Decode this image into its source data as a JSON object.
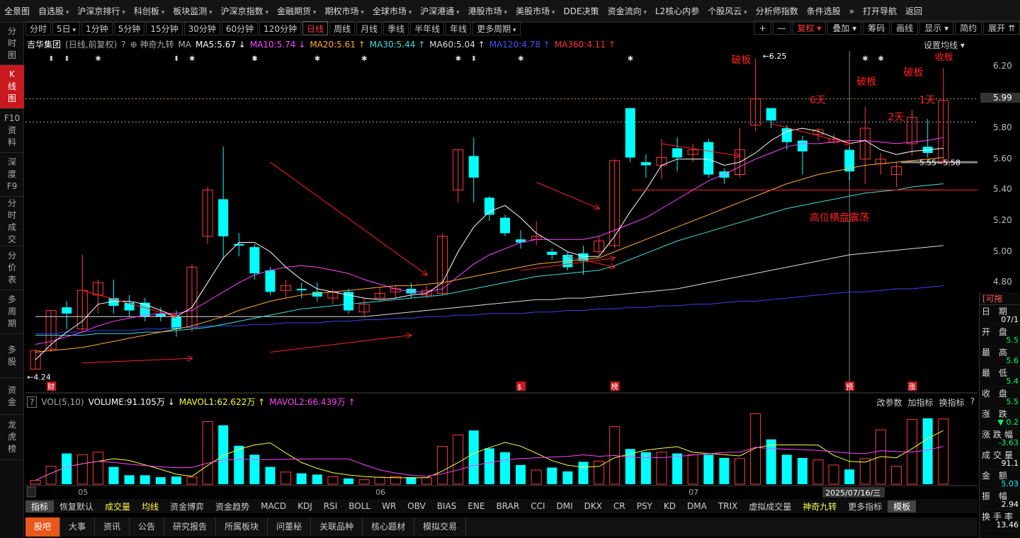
{
  "top_menu": [
    {
      "label": "全景图",
      "dd": false
    },
    {
      "label": "自选股",
      "dd": true
    },
    {
      "label": "沪深京排行",
      "dd": true
    },
    {
      "label": "科创板",
      "dd": true
    },
    {
      "label": "板块监测",
      "dd": true
    },
    {
      "label": "沪深京指数",
      "dd": true
    },
    {
      "label": "金融期货",
      "dd": true
    },
    {
      "label": "期权市场",
      "dd": true
    },
    {
      "label": "全球市场",
      "dd": true
    },
    {
      "label": "沪深港通",
      "dd": true
    },
    {
      "label": "港股市场",
      "dd": true
    },
    {
      "label": "美股市场",
      "dd": true
    },
    {
      "label": "DDE决策",
      "dd": false
    },
    {
      "label": "资金流向",
      "dd": true
    },
    {
      "label": "L2核心内参",
      "dd": false
    },
    {
      "label": "个股风云",
      "dd": true
    },
    {
      "label": "分析师指数",
      "dd": false
    },
    {
      "label": "条件选股",
      "dd": false
    },
    {
      "label": "»",
      "dd": false
    },
    {
      "label": "打开导航",
      "dd": false
    },
    {
      "label": "返回",
      "dd": false
    }
  ],
  "sidebar": [
    {
      "label": "分\n时\n图",
      "h": 60,
      "active": false
    },
    {
      "label": "K\n线\n图",
      "h": 62,
      "active": true
    },
    {
      "label": "F10\n资\n料",
      "h": 62,
      "active": false
    },
    {
      "label": "深\n度\nF9",
      "h": 62,
      "active": false
    },
    {
      "label": "分\n时\n成\n交",
      "h": 70,
      "active": false
    },
    {
      "label": "分\n价\n表",
      "h": 62,
      "active": false
    },
    {
      "label": "多\n周\n期",
      "h": 62,
      "active": false
    },
    {
      "label": "多\n股",
      "h": 62,
      "active": false
    },
    {
      "label": "资\n金",
      "h": 52,
      "active": false
    },
    {
      "label": "龙\n虎\n榜",
      "h": 64,
      "active": false
    }
  ],
  "periods": [
    {
      "label": "分时"
    },
    {
      "label": "5日",
      "dd": true
    },
    {
      "label": "1分钟"
    },
    {
      "label": "5分钟"
    },
    {
      "label": "15分钟"
    },
    {
      "label": "30分钟"
    },
    {
      "label": "60分钟"
    },
    {
      "label": "120分钟"
    },
    {
      "label": "日线",
      "active": true
    },
    {
      "label": "周线"
    },
    {
      "label": "月线"
    },
    {
      "label": "季线"
    },
    {
      "label": "半年线"
    },
    {
      "label": "年线"
    },
    {
      "label": "更多周期",
      "dd": true
    }
  ],
  "right_tools": [
    {
      "label": "+"
    },
    {
      "label": "—"
    },
    {
      "label": "复权 ▾",
      "red": true
    },
    {
      "label": "叠加 ▾"
    },
    {
      "label": "筹码"
    },
    {
      "label": "画线"
    },
    {
      "label": "显示 ▾"
    },
    {
      "label": "简约"
    },
    {
      "label": "展开 ⇈"
    }
  ],
  "ma_bar": [
    {
      "text": "吉华集团",
      "color": "#ffffff"
    },
    {
      "text": "(日线,前复权)",
      "color": "#aaaaaa"
    },
    {
      "text": "?",
      "color": "#aaaaaa"
    },
    {
      "text": "⊕ 神奇九转",
      "color": "#aaaaaa"
    },
    {
      "text": "MA",
      "color": "#aaaaaa"
    },
    {
      "text": "MA5:5.67 ↓",
      "color": "#ffffff"
    },
    {
      "text": "MA10:5.74 ↓",
      "color": "#ff44ff"
    },
    {
      "text": "MA20:5.61 ↑",
      "color": "#ffaa33"
    },
    {
      "text": "MA30:5.44 ↑",
      "color": "#44dddd"
    },
    {
      "text": "MA60:5.04 ↑",
      "color": "#dddddd"
    },
    {
      "text": "MA120:4.78 ↑",
      "color": "#4455ff"
    },
    {
      "text": "MA360:4.11 ↑",
      "color": "#ff3333"
    }
  ],
  "ma_settings": "设置均线 ▾",
  "colors": {
    "up": "#ff3b3b",
    "down": "#00ffff",
    "ma5": "#ffffff",
    "ma10": "#ff44ff",
    "ma20": "#ffaa33",
    "ma30": "#44dddd",
    "ma60": "#dddddd",
    "ma120": "#3344ee",
    "annot": "#ff2222"
  },
  "price_axis": {
    "min": 4.1,
    "max": 6.3,
    "ticks": [
      "6.20",
      "6.00",
      "5.80",
      "5.60",
      "5.40",
      "5.20",
      "5.00",
      "4.80"
    ]
  },
  "current_price_tag": "5.99",
  "top_markers": [
    "⬍",
    "⬍",
    "✱",
    "⬍",
    "✱",
    "⬍",
    "✱",
    "✱",
    "✱",
    "✱",
    "⬍",
    "✱",
    "✱",
    "✱",
    "✱"
  ],
  "chart_data": {
    "type": "candlestick",
    "title": "吉华集团",
    "candles": [
      {
        "o": 4.24,
        "c": 4.36,
        "h": 4.37,
        "l": 4.24
      },
      {
        "o": 4.37,
        "c": 4.62,
        "h": 4.62,
        "l": 4.35
      },
      {
        "o": 4.64,
        "c": 4.6,
        "h": 4.68,
        "l": 4.5
      },
      {
        "o": 4.5,
        "c": 4.75,
        "h": 4.98,
        "l": 4.48
      },
      {
        "o": 4.72,
        "c": 4.8,
        "h": 4.82,
        "l": 4.6
      },
      {
        "o": 4.7,
        "c": 4.65,
        "h": 4.82,
        "l": 4.6
      },
      {
        "o": 4.67,
        "c": 4.62,
        "h": 4.72,
        "l": 4.58
      },
      {
        "o": 4.67,
        "c": 4.58,
        "h": 4.7,
        "l": 4.55
      },
      {
        "o": 4.6,
        "c": 4.58,
        "h": 4.64,
        "l": 4.55
      },
      {
        "o": 4.58,
        "c": 4.5,
        "h": 4.62,
        "l": 4.45
      },
      {
        "o": 4.51,
        "c": 4.9,
        "h": 4.92,
        "l": 4.48
      },
      {
        "o": 5.1,
        "c": 5.4,
        "h": 5.42,
        "l": 5.05
      },
      {
        "o": 5.34,
        "c": 5.1,
        "h": 5.68,
        "l": 4.95
      },
      {
        "o": 5.05,
        "c": 5.04,
        "h": 5.12,
        "l": 4.97
      },
      {
        "o": 5.03,
        "c": 4.86,
        "h": 5.05,
        "l": 4.82
      },
      {
        "o": 4.88,
        "c": 4.74,
        "h": 4.9,
        "l": 4.72
      },
      {
        "o": 4.75,
        "c": 4.78,
        "h": 4.82,
        "l": 4.7
      },
      {
        "o": 4.76,
        "c": 4.75,
        "h": 4.8,
        "l": 4.7
      },
      {
        "o": 4.74,
        "c": 4.71,
        "h": 4.8,
        "l": 4.68
      },
      {
        "o": 4.7,
        "c": 4.74,
        "h": 4.76,
        "l": 4.66
      },
      {
        "o": 4.74,
        "c": 4.62,
        "h": 4.76,
        "l": 4.6
      },
      {
        "o": 4.61,
        "c": 4.66,
        "h": 4.7,
        "l": 4.58
      },
      {
        "o": 4.7,
        "c": 4.73,
        "h": 4.77,
        "l": 4.7
      },
      {
        "o": 4.74,
        "c": 4.76,
        "h": 4.78,
        "l": 4.7
      },
      {
        "o": 4.76,
        "c": 4.73,
        "h": 4.8,
        "l": 4.7
      },
      {
        "o": 4.72,
        "c": 4.75,
        "h": 4.78,
        "l": 4.7
      },
      {
        "o": 4.73,
        "c": 5.1,
        "h": 5.12,
        "l": 4.72
      },
      {
        "o": 5.4,
        "c": 5.66,
        "h": 5.66,
        "l": 5.32
      },
      {
        "o": 5.62,
        "c": 5.48,
        "h": 5.74,
        "l": 5.32
      },
      {
        "o": 5.35,
        "c": 5.24,
        "h": 5.36,
        "l": 5.2
      },
      {
        "o": 5.22,
        "c": 5.12,
        "h": 5.24,
        "l": 5.1
      },
      {
        "o": 5.08,
        "c": 5.06,
        "h": 5.14,
        "l": 5.02
      },
      {
        "o": 5.08,
        "c": 5.1,
        "h": 5.2,
        "l": 5.04
      },
      {
        "o": 5.0,
        "c": 4.98,
        "h": 5.02,
        "l": 4.95
      },
      {
        "o": 4.98,
        "c": 4.9,
        "h": 5.0,
        "l": 4.88
      },
      {
        "o": 4.99,
        "c": 4.94,
        "h": 5.04,
        "l": 4.85
      },
      {
        "o": 5.0,
        "c": 5.07,
        "h": 5.1,
        "l": 4.98
      },
      {
        "o": 5.04,
        "c": 5.59,
        "h": 5.6,
        "l": 5.02
      },
      {
        "o": 5.93,
        "c": 5.61,
        "h": 5.93,
        "l": 5.58
      },
      {
        "o": 5.58,
        "c": 5.56,
        "h": 5.63,
        "l": 5.48
      },
      {
        "o": 5.56,
        "c": 5.61,
        "h": 5.73,
        "l": 5.47
      },
      {
        "o": 5.67,
        "c": 5.61,
        "h": 5.74,
        "l": 5.52
      },
      {
        "o": 5.63,
        "c": 5.66,
        "h": 5.7,
        "l": 5.58
      },
      {
        "o": 5.71,
        "c": 5.5,
        "h": 5.73,
        "l": 5.48
      },
      {
        "o": 5.52,
        "c": 5.48,
        "h": 5.54,
        "l": 5.44
      },
      {
        "o": 5.5,
        "c": 5.66,
        "h": 5.8,
        "l": 5.48
      },
      {
        "o": 5.82,
        "c": 5.99,
        "h": 6.25,
        "l": 5.78
      },
      {
        "o": 5.93,
        "c": 5.85,
        "h": 5.93,
        "l": 5.8
      },
      {
        "o": 5.8,
        "c": 5.71,
        "h": 5.82,
        "l": 5.66
      },
      {
        "o": 5.72,
        "c": 5.65,
        "h": 5.75,
        "l": 5.5
      },
      {
        "o": 5.76,
        "c": 5.79,
        "h": 5.8,
        "l": 5.72
      },
      {
        "o": 5.71,
        "c": 5.73,
        "h": 5.76,
        "l": 5.7
      },
      {
        "o": 5.66,
        "c": 5.52,
        "h": 5.68,
        "l": 5.46
      },
      {
        "o": 5.6,
        "c": 5.8,
        "h": 5.94,
        "l": 5.44
      },
      {
        "o": 5.57,
        "c": 5.6,
        "h": 5.64,
        "l": 5.5
      },
      {
        "o": 5.5,
        "c": 5.55,
        "h": 5.58,
        "l": 5.42
      },
      {
        "o": 5.7,
        "c": 5.87,
        "h": 5.92,
        "l": 5.62
      },
      {
        "o": 5.68,
        "c": 5.64,
        "h": 5.86,
        "l": 5.61
      },
      {
        "o": 5.58,
        "c": 5.98,
        "h": 6.19,
        "l": 5.57
      }
    ],
    "ma5": [
      4.3,
      4.4,
      4.48,
      4.55,
      4.66,
      4.68,
      4.68,
      4.66,
      4.62,
      4.58,
      4.64,
      4.8,
      4.96,
      5.06,
      5.06,
      5.0,
      4.9,
      4.82,
      4.76,
      4.74,
      4.72,
      4.7,
      4.69,
      4.7,
      4.72,
      4.73,
      4.8,
      5.0,
      5.16,
      5.26,
      5.3,
      5.22,
      5.12,
      5.06,
      5.0,
      4.97,
      4.97,
      5.1,
      5.26,
      5.4,
      5.56,
      5.6,
      5.6,
      5.6,
      5.56,
      5.58,
      5.64,
      5.72,
      5.78,
      5.8,
      5.78,
      5.74,
      5.7,
      5.72,
      5.66,
      5.63,
      5.65,
      5.66,
      5.67
    ],
    "ma10": [
      4.4,
      4.42,
      4.45,
      4.48,
      4.52,
      4.55,
      4.57,
      4.59,
      4.6,
      4.6,
      4.62,
      4.68,
      4.74,
      4.8,
      4.85,
      4.88,
      4.9,
      4.91,
      4.9,
      4.88,
      4.86,
      4.82,
      4.79,
      4.76,
      4.74,
      4.74,
      4.76,
      4.84,
      4.92,
      4.98,
      5.02,
      5.06,
      5.08,
      5.08,
      5.08,
      5.08,
      5.1,
      5.14,
      5.18,
      5.22,
      5.28,
      5.34,
      5.4,
      5.46,
      5.5,
      5.55,
      5.6,
      5.64,
      5.68,
      5.7,
      5.7,
      5.71,
      5.72,
      5.72,
      5.71,
      5.7,
      5.71,
      5.72,
      5.74
    ],
    "ma20": [
      4.35,
      4.36,
      4.37,
      4.38,
      4.4,
      4.42,
      4.44,
      4.46,
      4.48,
      4.5,
      4.52,
      4.55,
      4.58,
      4.62,
      4.65,
      4.68,
      4.7,
      4.72,
      4.73,
      4.74,
      4.75,
      4.76,
      4.77,
      4.78,
      4.78,
      4.79,
      4.8,
      4.82,
      4.84,
      4.86,
      4.88,
      4.9,
      4.92,
      4.93,
      4.94,
      4.95,
      4.96,
      5.0,
      5.04,
      5.08,
      5.12,
      5.16,
      5.2,
      5.24,
      5.28,
      5.32,
      5.36,
      5.4,
      5.44,
      5.47,
      5.5,
      5.52,
      5.54,
      5.56,
      5.57,
      5.58,
      5.59,
      5.6,
      5.61
    ],
    "ma30": [
      4.46,
      4.46,
      4.46,
      4.46,
      4.47,
      4.47,
      4.47,
      4.48,
      4.48,
      4.49,
      4.5,
      4.51,
      4.53,
      4.55,
      4.57,
      4.59,
      4.61,
      4.63,
      4.64,
      4.65,
      4.66,
      4.67,
      4.68,
      4.69,
      4.7,
      4.71,
      4.72,
      4.74,
      4.76,
      4.78,
      4.8,
      4.82,
      4.84,
      4.85,
      4.86,
      4.87,
      4.88,
      4.91,
      4.95,
      4.99,
      5.03,
      5.07,
      5.1,
      5.13,
      5.16,
      5.19,
      5.22,
      5.25,
      5.28,
      5.3,
      5.32,
      5.34,
      5.36,
      5.38,
      5.39,
      5.4,
      5.42,
      5.43,
      5.44
    ],
    "ma60": [
      4.58,
      4.58,
      4.58,
      4.58,
      4.58,
      4.58,
      4.58,
      4.58,
      4.58,
      4.58,
      4.58,
      4.58,
      4.58,
      4.58,
      4.58,
      4.58,
      4.58,
      4.58,
      4.58,
      4.58,
      4.58,
      4.58,
      4.59,
      4.6,
      4.61,
      4.62,
      4.63,
      4.64,
      4.65,
      4.66,
      4.67,
      4.68,
      4.69,
      4.69,
      4.7,
      4.7,
      4.71,
      4.72,
      4.73,
      4.74,
      4.75,
      4.76,
      4.78,
      4.8,
      4.82,
      4.84,
      4.86,
      4.88,
      4.9,
      4.92,
      4.94,
      4.96,
      4.98,
      4.99,
      5.0,
      5.01,
      5.02,
      5.03,
      5.04
    ],
    "ma120": [
      4.47,
      4.47,
      4.48,
      4.48,
      4.49,
      4.49,
      4.49,
      4.5,
      4.5,
      4.51,
      4.51,
      4.52,
      4.52,
      4.52,
      4.53,
      4.53,
      4.54,
      4.54,
      4.54,
      4.55,
      4.55,
      4.56,
      4.56,
      4.57,
      4.57,
      4.58,
      4.58,
      4.59,
      4.59,
      4.6,
      4.6,
      4.6,
      4.61,
      4.61,
      4.62,
      4.62,
      4.63,
      4.63,
      4.64,
      4.64,
      4.65,
      4.65,
      4.66,
      4.66,
      4.67,
      4.68,
      4.68,
      4.69,
      4.7,
      4.71,
      4.72,
      4.73,
      4.74,
      4.74,
      4.75,
      4.76,
      4.76,
      4.77,
      4.78
    ],
    "volume_title": "VOL(5,10)",
    "vol_items": [
      {
        "text": "VOLUME:91.105万 ↓",
        "color": "#ffffff"
      },
      {
        "text": "MAVOL1:62.622万 ↑",
        "color": "#ffff33"
      },
      {
        "text": "MAVOL2:66.439万 ↑",
        "color": "#ff44ff"
      }
    ],
    "volume": [
      6,
      28,
      48,
      46,
      50,
      27,
      14,
      14,
      11,
      12,
      11,
      98,
      92,
      60,
      46,
      27,
      19,
      17,
      15,
      12,
      9,
      7,
      11,
      12,
      11,
      10,
      59,
      77,
      84,
      56,
      50,
      30,
      22,
      26,
      20,
      35,
      36,
      90,
      55,
      50,
      50,
      48,
      46,
      46,
      41,
      40,
      110,
      70,
      46,
      41,
      38,
      30,
      23,
      40,
      85,
      28,
      101,
      103,
      102
    ],
    "vol_axis_max": 115,
    "x_labels": [
      "05",
      "06",
      "07"
    ],
    "x_label_index": [
      3,
      22,
      42
    ],
    "date_tooltip": "2025/07/16/三",
    "cursor_index": 52
  },
  "annotations": [
    {
      "text": "破板",
      "i": 45,
      "p": 6.22,
      "size": 14
    },
    {
      "text": "←6.25",
      "i": 47,
      "p": 6.25,
      "size": 11,
      "color": "#ffffff"
    },
    {
      "text": "6天",
      "i": 50,
      "p": 5.96,
      "size": 14
    },
    {
      "text": "破板",
      "i": 53,
      "p": 6.08,
      "size": 14
    },
    {
      "text": "2天",
      "i": 55,
      "p": 5.85,
      "size": 14
    },
    {
      "text": "破板",
      "i": 56,
      "p": 6.14,
      "size": 14
    },
    {
      "text": "1天",
      "i": 57,
      "p": 5.96,
      "size": 14
    },
    {
      "text": "收板",
      "i": 58,
      "p": 6.24,
      "size": 13
    },
    {
      "text": "高位横盘震荡",
      "i": 50,
      "p": 5.2,
      "size": 14
    },
    {
      "text": "←4.24",
      "i": 0,
      "p": 4.17,
      "size": 11,
      "color": "#ffffff"
    },
    {
      "text": "5.55~5.58",
      "i": 57,
      "p": 5.56,
      "size": 11,
      "color": "#ffffff"
    }
  ],
  "bottom_badges": [
    {
      "text": "财",
      "i": 1
    },
    {
      "text": "$",
      "i": 31
    },
    {
      "text": "榜",
      "i": 37
    },
    {
      "text": "预",
      "i": 52
    },
    {
      "text": "涨",
      "i": 56
    }
  ],
  "vol_right_tools": [
    "改参数",
    "加指标",
    "换指标",
    "?"
  ],
  "indicators": [
    "指标",
    "恢复默认",
    "成交量",
    "均线",
    "资金博弈",
    "资金趋势",
    "MACD",
    "KDJ",
    "RSI",
    "BOLL",
    "WR",
    "OBV",
    "BIAS",
    "ENE",
    "BRAR",
    "CCI",
    "DMI",
    "DKX",
    "CR",
    "PSY",
    "KD",
    "DMA",
    "TRIX",
    "虚拟成交量",
    "神奇九转",
    "更多指标",
    "模板"
  ],
  "bottom_tabs": [
    "股吧",
    "大事",
    "资讯",
    "公告",
    "研究报告",
    "所属板块",
    "问董秘",
    "关联品种",
    "核心题材",
    "模拟交易"
  ],
  "right_panel": {
    "header": "[可拖",
    "rows": [
      {
        "label": "日 期",
        "value": "07/1",
        "color": "#ffffff"
      },
      {
        "label": "开 盘",
        "value": "5.5",
        "color": "#00ff66"
      },
      {
        "label": "最 高",
        "value": "5.6",
        "color": "#00ff66"
      },
      {
        "label": "最 低",
        "value": "5.4",
        "color": "#00ff66"
      },
      {
        "label": "收 盘",
        "value": "5.5",
        "color": "#00ff66"
      },
      {
        "label": "涨 跌",
        "value": "▼ 0.2",
        "color": "#00ff66"
      },
      {
        "label": "涨跌幅",
        "value": "-3.63",
        "color": "#00ff66"
      },
      {
        "label": "成交量",
        "value": "91.1",
        "color": "#ffffff"
      },
      {
        "label": "金 额",
        "value": "5.03",
        "color": "#00ffff"
      },
      {
        "label": "振 幅",
        "value": "2.94",
        "color": "#ffffff"
      },
      {
        "label": "换手率",
        "value": "13.46",
        "color": "#ffffff"
      }
    ]
  }
}
